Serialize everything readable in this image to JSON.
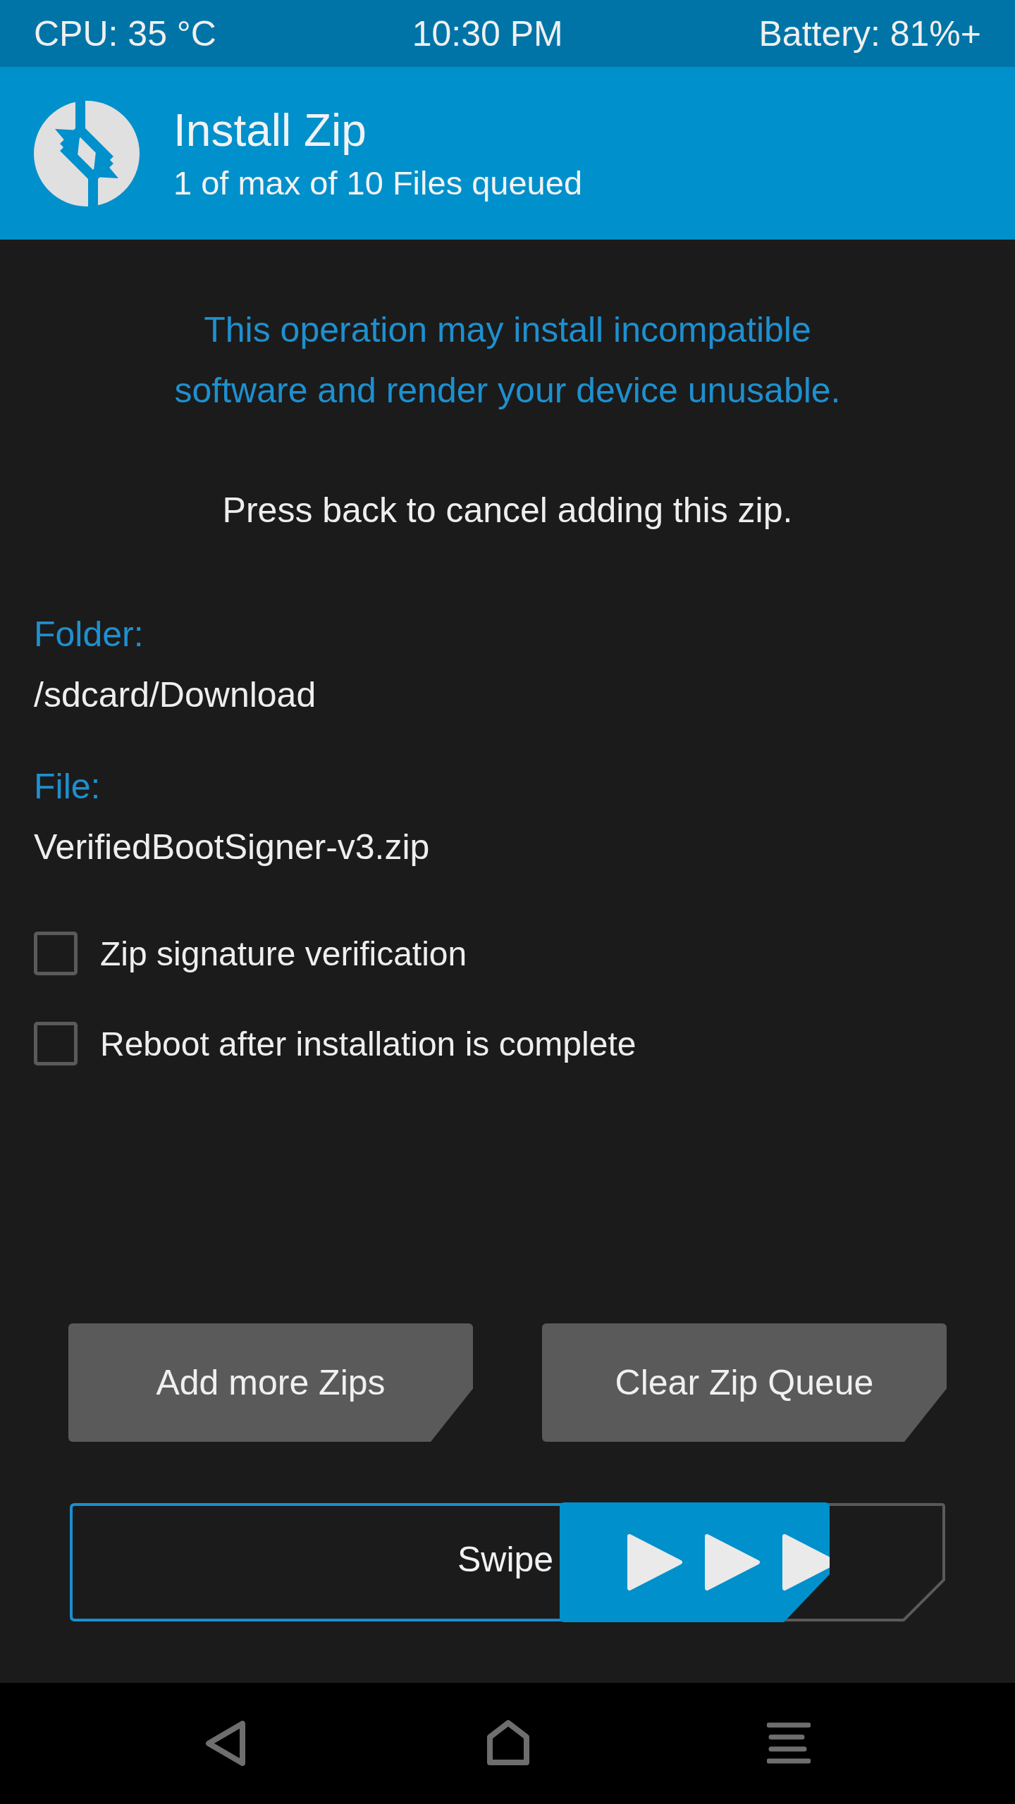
{
  "status_bar": {
    "cpu": "CPU: 35 °C",
    "time": "10:30 PM",
    "battery": "Battery: 81%+"
  },
  "header": {
    "title": "Install Zip",
    "subtitle": "1 of max of 10 Files queued"
  },
  "warning": "This operation may install incompatible software and render your device unusable.",
  "hint": "Press back to cancel adding this zip.",
  "fields": [
    {
      "label": "Folder:",
      "value": "/sdcard/Download"
    },
    {
      "label": "File:",
      "value": "VerifiedBootSigner-v3.zip"
    }
  ],
  "options": [
    {
      "label": "Zip signature verification",
      "checked": false
    },
    {
      "label": "Reboot after installation is complete",
      "checked": false
    }
  ],
  "buttons": [
    "Add more Zips",
    "Clear Zip Queue"
  ],
  "swipe": {
    "label": "Swipe",
    "level": 0.81
  }
}
